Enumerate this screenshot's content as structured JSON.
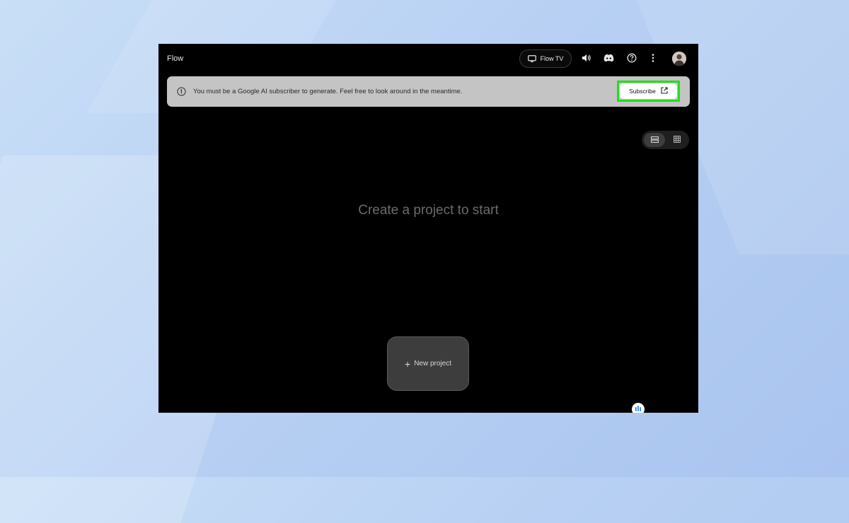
{
  "app": {
    "title": "Flow"
  },
  "toolbar": {
    "flow_tv_label": "Flow TV",
    "icons": [
      "tv-icon",
      "volume-icon",
      "discord-icon",
      "help-icon",
      "more-vert-icon",
      "avatar"
    ]
  },
  "banner": {
    "message": "You must be a Google AI subscriber to generate. Feel free to look around in the meantime.",
    "subscribe_label": "Subscribe",
    "highlight_color": "#22e01a"
  },
  "view_toggle": {
    "options": [
      "list",
      "grid"
    ],
    "selected": "list"
  },
  "main": {
    "empty_message": "Create a project to start"
  },
  "new_project": {
    "label": "New project"
  },
  "colors": {
    "accent": "#1a73e8",
    "window_bg": "#000000",
    "banner_bg": "#c4c4c4"
  }
}
